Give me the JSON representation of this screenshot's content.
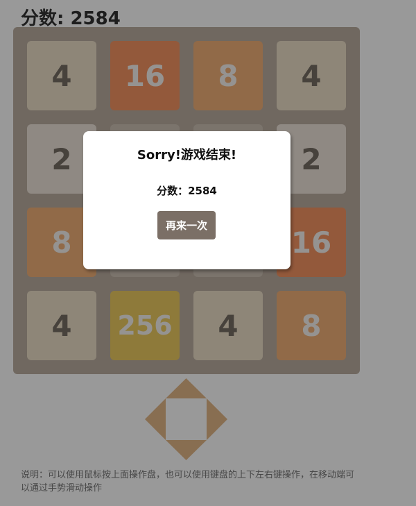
{
  "header": {
    "score_label": "分数: 2584"
  },
  "board": {
    "rows": [
      [
        "4",
        "16",
        "8",
        "4"
      ],
      [
        "2",
        "",
        "",
        "2"
      ],
      [
        "8",
        "",
        "",
        "16"
      ],
      [
        "4",
        "256",
        "4",
        "8"
      ]
    ],
    "colors": {
      "2": {
        "bg": "#eee4da",
        "fg": "#776e65"
      },
      "4": {
        "bg": "#ede0c8",
        "fg": "#776e65"
      },
      "8": {
        "bg": "#f2b179",
        "fg": "#f9f6f2"
      },
      "16": {
        "bg": "#f59563",
        "fg": "#f9f6f2"
      },
      "256": {
        "bg": "#edcc61",
        "fg": "#f9f6f2"
      },
      "board": "#bbada0",
      "empty": "#cdc1b4"
    }
  },
  "controls": {
    "up_icon": "triangle-up-icon",
    "down_icon": "triangle-down-icon",
    "left_icon": "triangle-left-icon",
    "right_icon": "triangle-right-icon",
    "color": "#e3b887"
  },
  "instructions": {
    "text": "说明：可以使用鼠标按上面操作盘，也可以使用键盘的上下左右键操作，在移动端可以通过手势滑动操作"
  },
  "dialog": {
    "title": "Sorry!游戏结束!",
    "score_text": "分数：2584",
    "button_label": "再来一次"
  }
}
